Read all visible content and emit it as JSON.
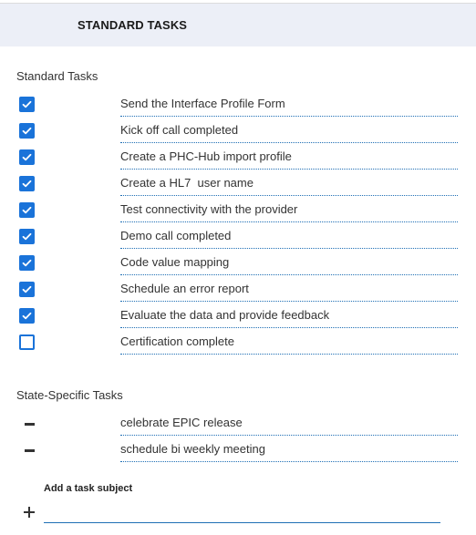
{
  "header": {
    "title": "STANDARD TASKS"
  },
  "standard_tasks": {
    "label": "Standard Tasks",
    "items": [
      {
        "label": "Send the Interface Profile Form",
        "checked": true
      },
      {
        "label": "Kick off call completed",
        "checked": true
      },
      {
        "label": "Create a PHC-Hub import profile",
        "checked": true
      },
      {
        "label": "Create a HL7  user name",
        "checked": true
      },
      {
        "label": "Test connectivity with the provider",
        "checked": true
      },
      {
        "label": "Demo call completed",
        "checked": true
      },
      {
        "label": "Code value mapping",
        "checked": true
      },
      {
        "label": "Schedule an error report",
        "checked": true
      },
      {
        "label": "Evaluate the data and provide feedback",
        "checked": true
      },
      {
        "label": "Certification complete",
        "checked": false
      }
    ]
  },
  "state_specific_tasks": {
    "label": "State-Specific Tasks",
    "items": [
      {
        "label": "celebrate EPIC release",
        "icon": "minus-icon"
      },
      {
        "label": "schedule bi weekly meeting",
        "icon": "minus-icon"
      }
    ]
  },
  "add_task": {
    "label": "Add a task subject",
    "value": "",
    "placeholder": "",
    "icon": "plus-icon"
  },
  "colors": {
    "accent": "#1a73d9",
    "header_bg": "#eceff7",
    "divider": "#1f6fb5"
  }
}
